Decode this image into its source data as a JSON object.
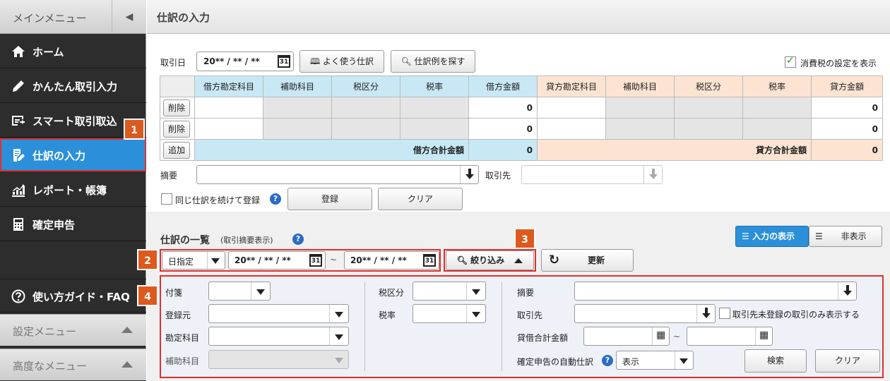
{
  "sidebar": {
    "header": "メインメニュー",
    "items": [
      {
        "label": "ホーム"
      },
      {
        "label": "かんたん取引入力"
      },
      {
        "label": "スマート取引取込"
      },
      {
        "label": "仕訳の入力"
      },
      {
        "label": "レポート・帳簿"
      },
      {
        "label": "確定申告"
      }
    ],
    "guide": "使い方ガイド・FAQ",
    "settings_menu": "設定メニュー",
    "advanced_menu": "高度なメニュー"
  },
  "badges": [
    "1",
    "2",
    "3",
    "4"
  ],
  "page_title": "仕訳の入力",
  "entry": {
    "date_label": "取引日",
    "date_value": "20** / ** / **",
    "favorites_button": "よく使う仕訳",
    "search_examples_button": "仕訳例を探す",
    "tax_setting_label": "消費税の設定を表示",
    "tax_setting_checked": true,
    "debit_headers": [
      "借方勘定科目",
      "補助科目",
      "税区分",
      "税率",
      "借方金額"
    ],
    "credit_headers": [
      "貸方勘定科目",
      "補助科目",
      "税区分",
      "税率",
      "貸方金額"
    ],
    "rows": [
      {
        "action": "削除",
        "debit_amount": "0",
        "credit_amount": "0"
      },
      {
        "action": "削除",
        "debit_amount": "0",
        "credit_amount": "0"
      }
    ],
    "add_button": "追加",
    "debit_total_label": "借方合計金額",
    "debit_total": "0",
    "credit_total_label": "貸方合計金額",
    "credit_total": "0",
    "summary_label": "摘要",
    "partner_label": "取引先",
    "continue_label": "同じ仕訳を続けて登録",
    "register_button": "登録",
    "clear_button": "クリア"
  },
  "list": {
    "title": "仕訳の一覧",
    "subtitle": "(取引摘要表示)",
    "show_input_button": "入力の表示",
    "hide_button": "非表示",
    "date_mode": "日指定",
    "date_from": "20** / ** / **",
    "tilde": "~",
    "date_to": "20** / ** / **",
    "filter_button": "絞り込み",
    "refresh_button": "更新"
  },
  "filter": {
    "tag_label": "付箋",
    "source_label": "登録元",
    "account_label": "勘定科目",
    "sub_account_label": "補助科目",
    "tax_category_label": "税区分",
    "tax_rate_label": "税率",
    "summary_label": "摘要",
    "partner_label": "取引先",
    "unregistered_partner_label": "取引先未登録の取引のみ表示する",
    "amount_label": "貸借合計金額",
    "tilde": "~",
    "auto_entry_label": "確定申告の自動仕訳",
    "auto_entry_value": "表示",
    "search_button": "検索",
    "clear_button": "クリア"
  }
}
